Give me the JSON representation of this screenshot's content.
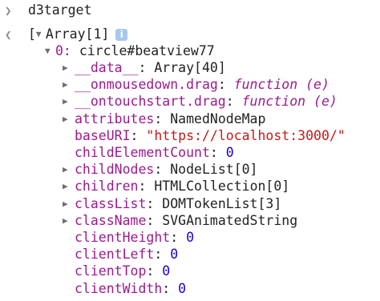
{
  "console": {
    "input": {
      "prompt_icon": "chevron-right-icon",
      "expression": "d3target"
    },
    "result": {
      "return_icon": "chevron-left-icon",
      "bracket": "[",
      "summary": "Array[1]",
      "info_badge": "i"
    },
    "item0": {
      "index_label": "0:",
      "value": "circle#beatview77"
    },
    "properties": [
      {
        "key": "__data__",
        "value": "Array[40]",
        "kind": "plain",
        "expandable": true
      },
      {
        "key": "__onmousedown.drag",
        "value": "function (e)",
        "kind": "function",
        "expandable": true
      },
      {
        "key": "__ontouchstart.drag",
        "value": "function (e)",
        "kind": "function",
        "expandable": true
      },
      {
        "key": "attributes",
        "value": "NamedNodeMap",
        "kind": "plain",
        "expandable": true
      },
      {
        "key": "baseURI",
        "value": "\"https://localhost:3000/\"",
        "kind": "string",
        "expandable": false
      },
      {
        "key": "childElementCount",
        "value": "0",
        "kind": "number",
        "expandable": false
      },
      {
        "key": "childNodes",
        "value": "NodeList[0]",
        "kind": "plain",
        "expandable": true
      },
      {
        "key": "children",
        "value": "HTMLCollection[0]",
        "kind": "plain",
        "expandable": true
      },
      {
        "key": "classList",
        "value": "DOMTokenList[3]",
        "kind": "plain",
        "expandable": true
      },
      {
        "key": "className",
        "value": "SVGAnimatedString",
        "kind": "plain",
        "expandable": true
      },
      {
        "key": "clientHeight",
        "value": "0",
        "kind": "number",
        "expandable": false
      },
      {
        "key": "clientLeft",
        "value": "0",
        "kind": "number",
        "expandable": false
      },
      {
        "key": "clientTop",
        "value": "0",
        "kind": "number",
        "expandable": false
      },
      {
        "key": "clientWidth",
        "value": "0",
        "kind": "number",
        "expandable": false
      }
    ],
    "colors": {
      "key": "#9b1a8d",
      "string": "#c41a16",
      "number": "#1c00cf",
      "function_keyword": "#9b1a8d",
      "badge": "#a9c6ee"
    }
  }
}
